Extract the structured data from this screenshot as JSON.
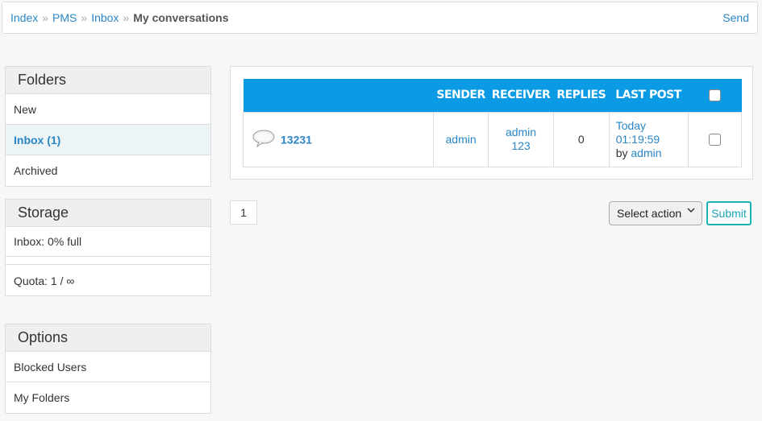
{
  "breadcrumb": {
    "items": [
      "Index",
      "PMS",
      "Inbox"
    ],
    "separator": "»",
    "current": "My conversations",
    "send_label": "Send"
  },
  "folders": {
    "title": "Folders",
    "items": [
      "New",
      "Inbox (1)",
      "Archived"
    ]
  },
  "storage": {
    "title": "Storage",
    "inbox_usage": "Inbox: 0% full",
    "progress_percent": 0,
    "quota": "Quota: 1 / ∞"
  },
  "options": {
    "title": "Options",
    "items": [
      "Blocked Users",
      "My Folders"
    ]
  },
  "table": {
    "headers": [
      "SENDER",
      "RECEIVER",
      "REPLIES",
      "LAST POST"
    ],
    "rows": [
      {
        "icon": "speech-bubble-icon",
        "subject": "13231",
        "sender": "admin",
        "receiver": "admin 123",
        "replies": "0",
        "last_post_when": "Today 01:19:59",
        "last_post_by_prefix": "by",
        "last_post_by": "admin"
      }
    ]
  },
  "pagination": {
    "current_page": "1"
  },
  "actions": {
    "select_label": "Select action",
    "submit_label": "Submit"
  },
  "colors": {
    "header_blue": "#0a9be4",
    "link_blue": "#2a86c6",
    "submit_teal": "#1bb5b5"
  }
}
